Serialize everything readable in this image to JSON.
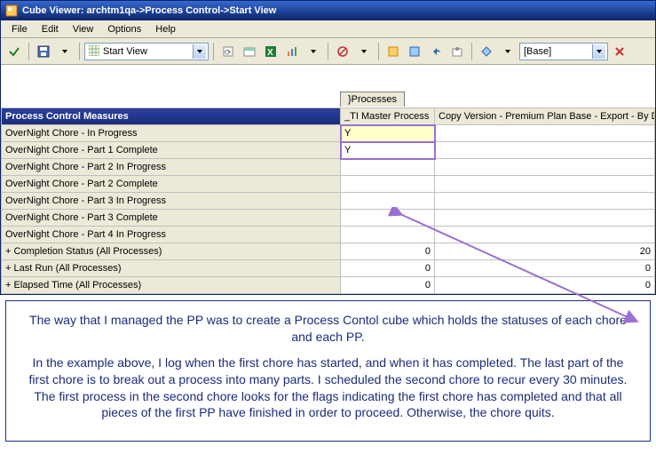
{
  "window": {
    "title": "Cube Viewer: archtm1qa->Process Control->Start View"
  },
  "menu": {
    "file": "File",
    "edit": "Edit",
    "view": "View",
    "options": "Options",
    "help": "Help"
  },
  "toolbar": {
    "view_combo": "Start View",
    "base_combo": "[Base]"
  },
  "grid": {
    "tab": "}Processes",
    "corner": "Process Control Measures",
    "cols": [
      "_TI  Master Process",
      "Copy Version - Premium Plan Base - Export - By Division"
    ],
    "rows": [
      {
        "label": "OverNight Chore - In Progress",
        "plus": false,
        "cells": [
          "Y",
          ""
        ],
        "hl": true,
        "sel": true
      },
      {
        "label": "OverNight Chore - Part 1 Complete",
        "plus": false,
        "cells": [
          "Y",
          ""
        ],
        "hl": false,
        "sel": true
      },
      {
        "label": "OverNight Chore - Part 2 In Progress",
        "plus": false,
        "cells": [
          "",
          ""
        ],
        "hl": false
      },
      {
        "label": "OverNight Chore - Part 2 Complete",
        "plus": false,
        "cells": [
          "",
          ""
        ],
        "hl": false
      },
      {
        "label": "OverNight Chore - Part 3 In Progress",
        "plus": false,
        "cells": [
          "",
          ""
        ],
        "hl": false
      },
      {
        "label": "OverNight Chore - Part 3 Complete",
        "plus": false,
        "cells": [
          "",
          ""
        ],
        "hl": false
      },
      {
        "label": "OverNight Chore - Part 4 In Progress",
        "plus": false,
        "cells": [
          "",
          ""
        ],
        "hl": false
      },
      {
        "label": "Completion Status (All Processes)",
        "plus": true,
        "cells": [
          "0",
          "20"
        ],
        "num": true
      },
      {
        "label": "Last Run (All Processes)",
        "plus": true,
        "cells": [
          "0",
          "0"
        ],
        "num": true
      },
      {
        "label": "Elapsed Time (All Processes)",
        "plus": true,
        "cells": [
          "0",
          "0"
        ],
        "num": true
      }
    ]
  },
  "caption": {
    "p1": "The way that I managed the PP was to create a Process Contol cube which holds the statuses of each chore and each PP.",
    "p2": "In the example above, I log when the first chore has started, and when it has completed.  The last part of the first chore is to break out a process into many parts.  I scheduled the second chore to recur every 30 minutes.  The first process in the second chore looks for the flags indicating the first chore has completed and that all pieces of the first PP have finished in order to proceed.  Otherwise, the chore quits."
  }
}
